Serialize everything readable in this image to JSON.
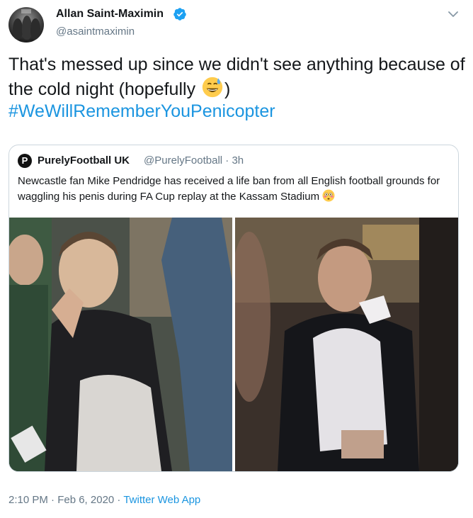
{
  "header": {
    "display_name": "Allan Saint-Maximin",
    "handle": "@asaintmaximin",
    "verified_icon": "verified-badge-icon",
    "menu_icon": "chevron-down-icon"
  },
  "tweet": {
    "text_part1": "That's messed up since we didn't see anything because of the cold night (hopefully ",
    "text_part2": ")",
    "emoji": "grinning-sweat-emoji",
    "hashtag": "#WeWillRememberYouPenicopter"
  },
  "quoted_tweet": {
    "logo_letter": "P",
    "display_name": "PurelyFootball UK",
    "handle_time": "@PurelyFootball · 3h",
    "text": "Newcastle fan Mike Pendridge has received a life ban from all English football grounds for waggling his penis during FA Cup replay at the Kassam Stadium",
    "emoji": "flushed-face-emoji"
  },
  "footer": {
    "timestamp": "2:10 PM · Feb 6, 2020 · ",
    "source": "Twitter Web App"
  },
  "colors": {
    "link": "#1b95e0",
    "secondary_text": "#657786",
    "border": "#ccd6dd"
  }
}
